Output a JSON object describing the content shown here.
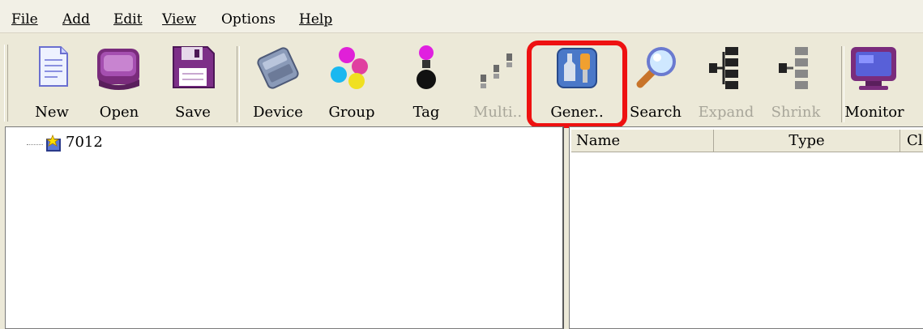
{
  "menu": {
    "file": "File",
    "add": "Add",
    "edit": "Edit",
    "view": "View",
    "options": "Options",
    "help": "Help"
  },
  "toolbar": {
    "buttons": [
      {
        "label": "New",
        "icon": "new-document-icon",
        "enabled": true
      },
      {
        "label": "Open",
        "icon": "open-folder-icon",
        "enabled": true
      },
      {
        "label": "Save",
        "icon": "floppy-disk-icon",
        "enabled": true
      },
      {
        "label": "Device",
        "icon": "device-module-icon",
        "enabled": true
      },
      {
        "label": "Group",
        "icon": "group-balls-icon",
        "enabled": true
      },
      {
        "label": "Tag",
        "icon": "tag-icon",
        "enabled": true
      },
      {
        "label": "Multi..",
        "icon": "multi-blocks-icon",
        "enabled": false
      },
      {
        "label": "Gener..",
        "icon": "tools-wrench-screwdriver-icon",
        "enabled": true,
        "highlighted": true
      },
      {
        "label": "Search",
        "icon": "magnifier-icon",
        "enabled": true
      },
      {
        "label": "Expand",
        "icon": "expand-tree-icon",
        "enabled": false
      },
      {
        "label": "Shrink",
        "icon": "shrink-tree-icon",
        "enabled": false
      },
      {
        "label": "Monitor",
        "icon": "monitor-icon",
        "enabled": true
      }
    ],
    "highlight_color": "#ee1111"
  },
  "tree": {
    "root_label": "7012",
    "root_icon": "module-node-icon"
  },
  "list": {
    "columns": [
      "Name",
      "Type",
      "Cl"
    ]
  }
}
